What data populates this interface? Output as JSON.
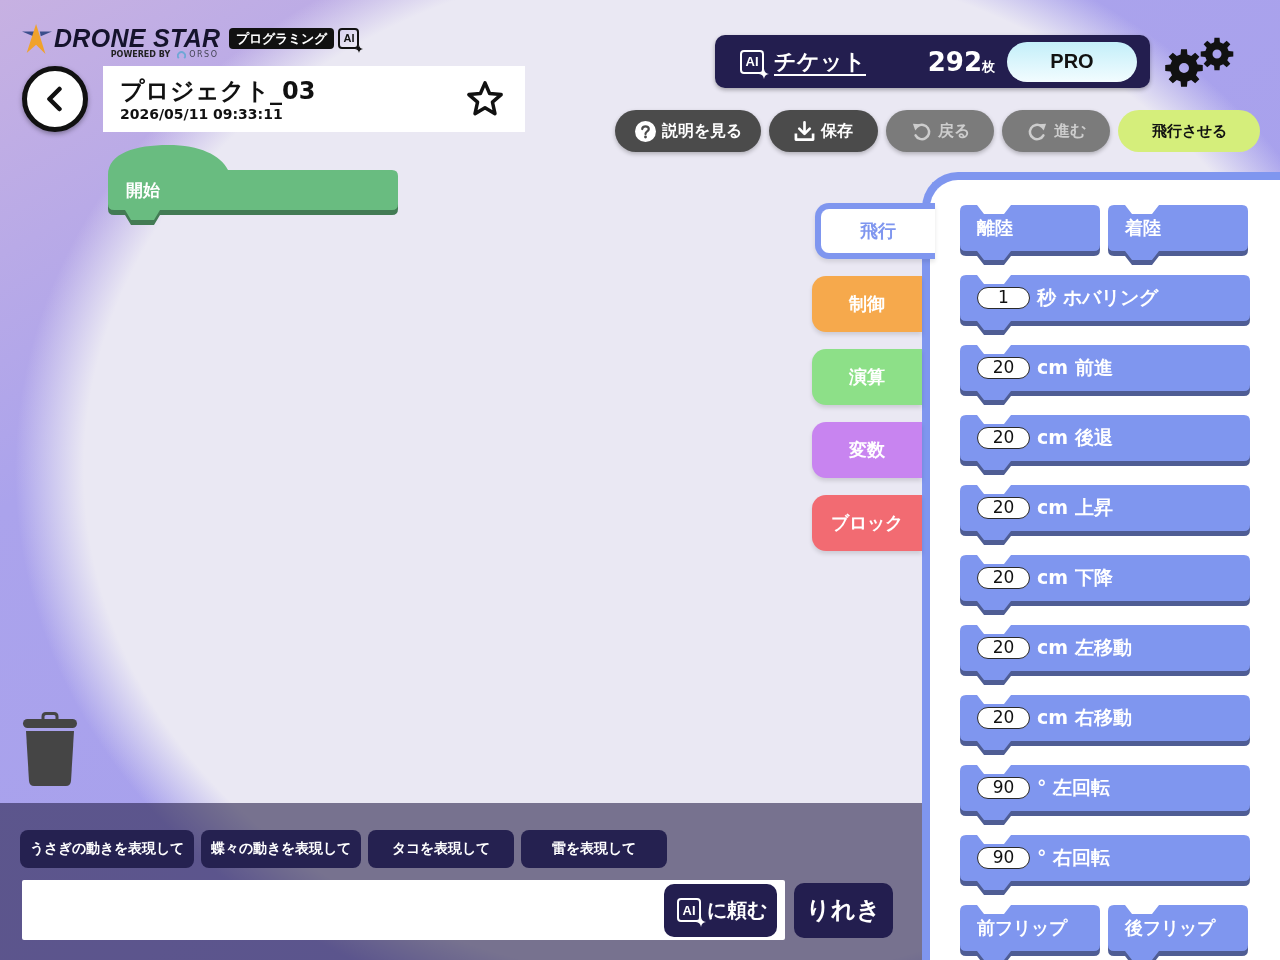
{
  "logo": {
    "title": "DRONE STAR",
    "powered_by": "POWERED BY",
    "partner": "ORSO",
    "badge": "プログラミング",
    "ai_mark": "AI"
  },
  "project": {
    "title": "プロジェクト_03",
    "timestamp": "2026/05/11 09:33:11",
    "starred": false
  },
  "tickets": {
    "ai_mark": "AI",
    "label": "チケット",
    "count": "292",
    "unit": "枚",
    "plan": "PRO"
  },
  "toolbar": [
    {
      "kind": "help",
      "label": "説明を見る",
      "disabled": false
    },
    {
      "kind": "save",
      "label": "保存",
      "disabled": false
    },
    {
      "kind": "undo",
      "label": "戻る",
      "disabled": true
    },
    {
      "kind": "redo",
      "label": "進む",
      "disabled": true
    },
    {
      "kind": "fly",
      "label": "飛行させる",
      "disabled": false
    }
  ],
  "workspace": {
    "blocks": [
      {
        "kind": "start",
        "label": "開始"
      }
    ]
  },
  "categories": [
    {
      "label": "飛行",
      "color": "#7f96ef",
      "selected": true
    },
    {
      "label": "制御",
      "color": "#f6a94c",
      "selected": false
    },
    {
      "label": "演算",
      "color": "#8de088",
      "selected": false
    },
    {
      "label": "変数",
      "color": "#c884f0",
      "selected": false
    },
    {
      "label": "ブロック",
      "color": "#f26b72",
      "selected": false
    }
  ],
  "palette": [
    {
      "kind": "pair",
      "labels": [
        "離陸",
        "着陸"
      ]
    },
    {
      "kind": "input",
      "value": "1",
      "label": "秒 ホバリング"
    },
    {
      "kind": "input",
      "value": "20",
      "label": "cm 前進"
    },
    {
      "kind": "input",
      "value": "20",
      "label": "cm 後退"
    },
    {
      "kind": "input",
      "value": "20",
      "label": "cm 上昇"
    },
    {
      "kind": "input",
      "value": "20",
      "label": "cm 下降"
    },
    {
      "kind": "input",
      "value": "20",
      "label": "cm 左移動"
    },
    {
      "kind": "input",
      "value": "20",
      "label": "cm 右移動"
    },
    {
      "kind": "input",
      "value": "90",
      "label": "° 左回転"
    },
    {
      "kind": "input",
      "value": "90",
      "label": "° 右回転"
    },
    {
      "kind": "pair",
      "labels": [
        "前フリップ",
        "後フリップ"
      ]
    }
  ],
  "prompt": {
    "suggestions": [
      "うさぎの動きを表現して",
      "蝶々の動きを表現して",
      "タコを表現して",
      "雷を表現して"
    ],
    "ask_button": {
      "ai_mark": "AI",
      "label": "に頼む"
    },
    "history_button": "りれき"
  }
}
